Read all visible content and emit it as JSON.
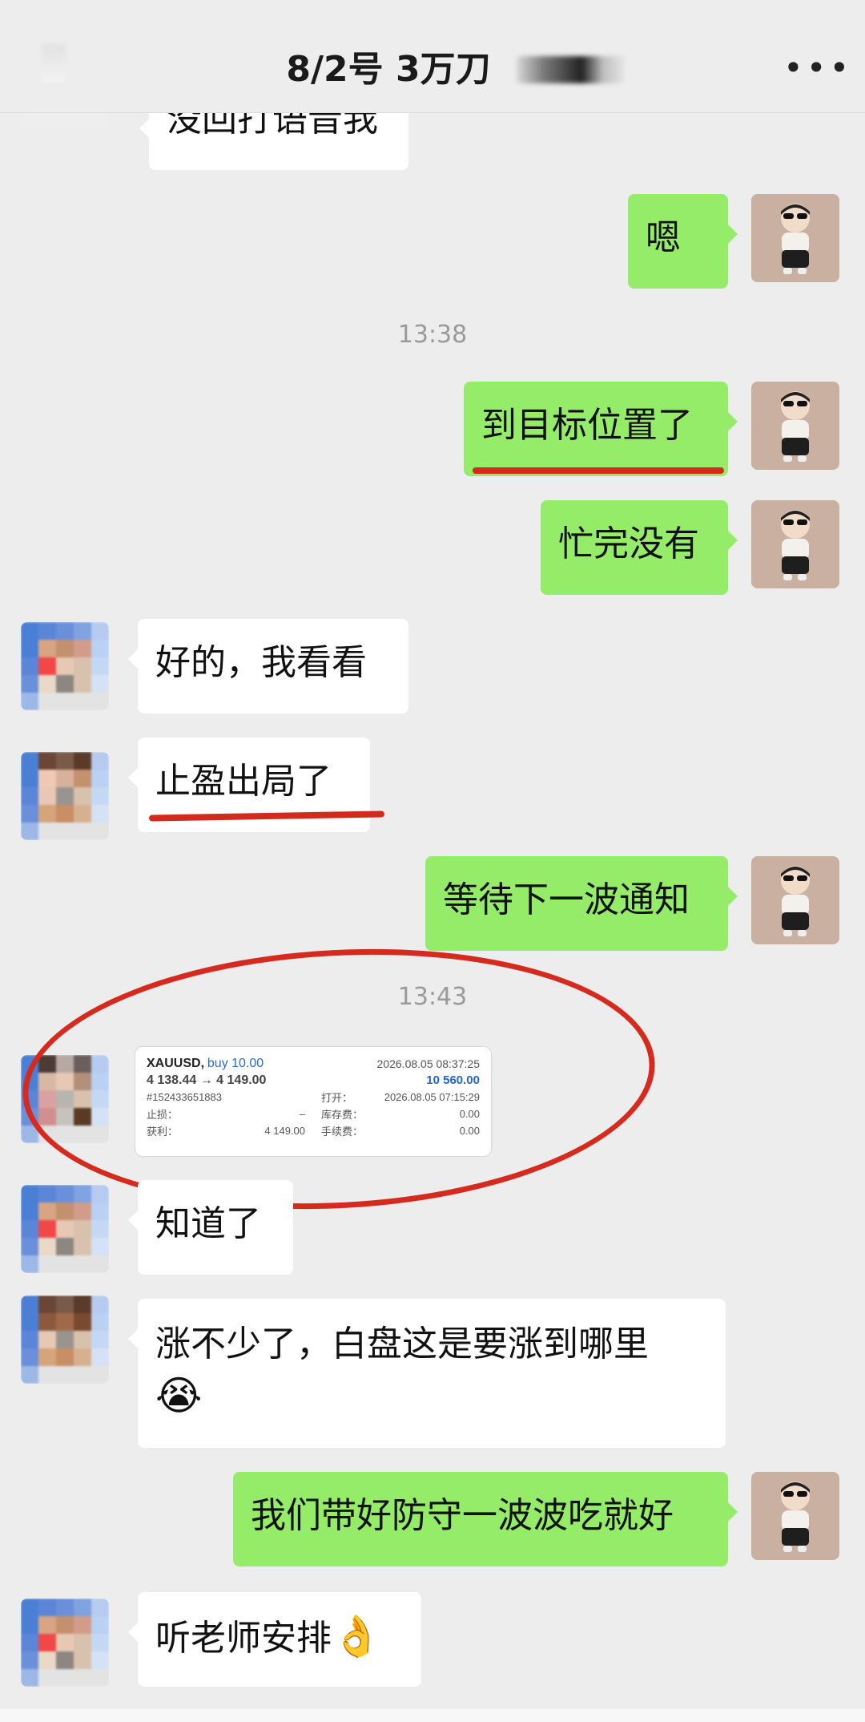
{
  "header": {
    "title": "8/2号  3万刀",
    "more_label": "•••"
  },
  "timestamps": {
    "t1": "13:38",
    "t2": "13:43"
  },
  "messages": {
    "m0": "没回打语音我",
    "m1": "嗯",
    "m2": "到目标位置了",
    "m3": "忙完没有",
    "m4": "好的，我看看",
    "m5": "止盈出局了",
    "m6": "等待下一波通知",
    "m8": "知道了",
    "m9": "涨不少了，白盘这是要涨到哪里",
    "m9_emoji": "😭",
    "m10": "我们带好防守一波波吃就好",
    "m11": "听老师安排",
    "m11_emoji": "👌"
  },
  "trade": {
    "symbol": "XAUUSD,",
    "side": "buy 10.00",
    "close_time": "2026.08.05 08:37:25",
    "price_change": "4 138.44 → 4 149.00",
    "profit": "10 560.00",
    "order_id": "#152433651883",
    "open_label": "打开：",
    "open_time": "2026.08.05 07:15:29",
    "sl_label": "止损：",
    "sl_value": "–",
    "swap_label": "库存费：",
    "swap_value": "0.00",
    "tp_label": "获利：",
    "tp_value": "4 149.00",
    "fee_label": "手续费：",
    "fee_value": "0.00"
  },
  "colors": {
    "outgoing_bubble": "#95ec69",
    "incoming_bubble": "#ffffff",
    "annotation_red": "#d42a1d",
    "background": "#ededed"
  }
}
